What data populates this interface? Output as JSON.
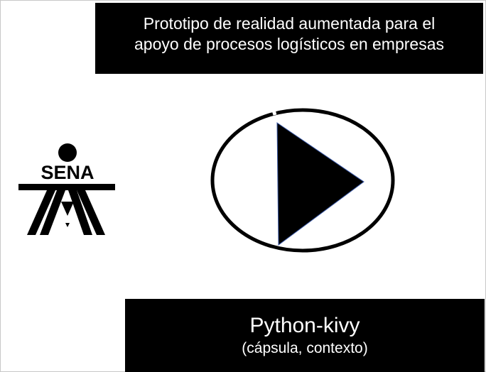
{
  "header": {
    "title": "Prototipo de realidad aumentada para el\napoyo de procesos logísticos en empresas"
  },
  "logo": {
    "text": "SENA",
    "icon": "sena-logo-icon"
  },
  "video": {
    "icon": "play-icon"
  },
  "caption": {
    "title": "Python-kivy",
    "subtitle": "(cápsula, contexto)"
  },
  "colors": {
    "background": "#ffffff",
    "box": "#000000",
    "text_on_box": "#ffffff"
  }
}
